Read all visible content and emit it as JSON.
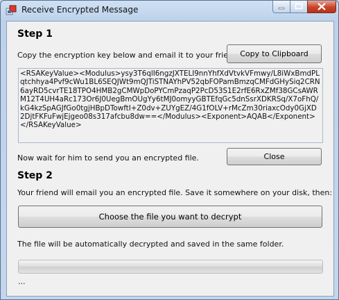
{
  "window": {
    "title": "Receive Encrypted Message",
    "icons": {
      "app": "app-icon",
      "minimize": "minimize-icon",
      "maximize": "maximize-icon",
      "close": "close-icon"
    }
  },
  "step1": {
    "heading": "Step 1",
    "instruction": "Copy the encryption key below and email it to your friend:",
    "copy_button": "Copy to Clipboard",
    "key_text": "<RSAKeyValue><Modulus>ysy3T6qlI6ngzJXTELI9nnYhfXdVtvkVFmwy/L8iWxBmdPLqtchhya4Pvf9cWu1BL6SEQJWt9mQJTiSTNAYhPV52qbFOPamBmzqCMFdGHySiq2CRN6ayRD5cvrTE18TPO4HMB2gCMWpDoPYCmPzaqP2PcD53S1E2rfE6RxZMf38GCsAWRM12T4UH4aRc173Or6J0UegBmOUgYy6tMJ0omyyGBTEfqGc5dnSsrXDKRSq/X7oFhQ/kG4kzSpAGJfGo0tgjHBpDTowftI+Z0dv+ZUYgEZ/4G1fOLV+rMcZm30riaxcOdy0GjXD2DjtFKFuFwjEjgeo08s317afcbu8dw==</Modulus><Exponent>AQAB</Exponent></RSAKeyValue>",
    "wait_text": "Now wait for him to send you an encrypted file.",
    "close_button": "Close"
  },
  "step2": {
    "heading": "Step 2",
    "instruction": "Your friend will email you an encrypted file. Save it somewhere on your disk, then:",
    "choose_button": "Choose the file you want to decrypt",
    "auto_text": "The file will be automatically decrypted and saved in the same folder.",
    "progress": 0,
    "status": "..."
  }
}
